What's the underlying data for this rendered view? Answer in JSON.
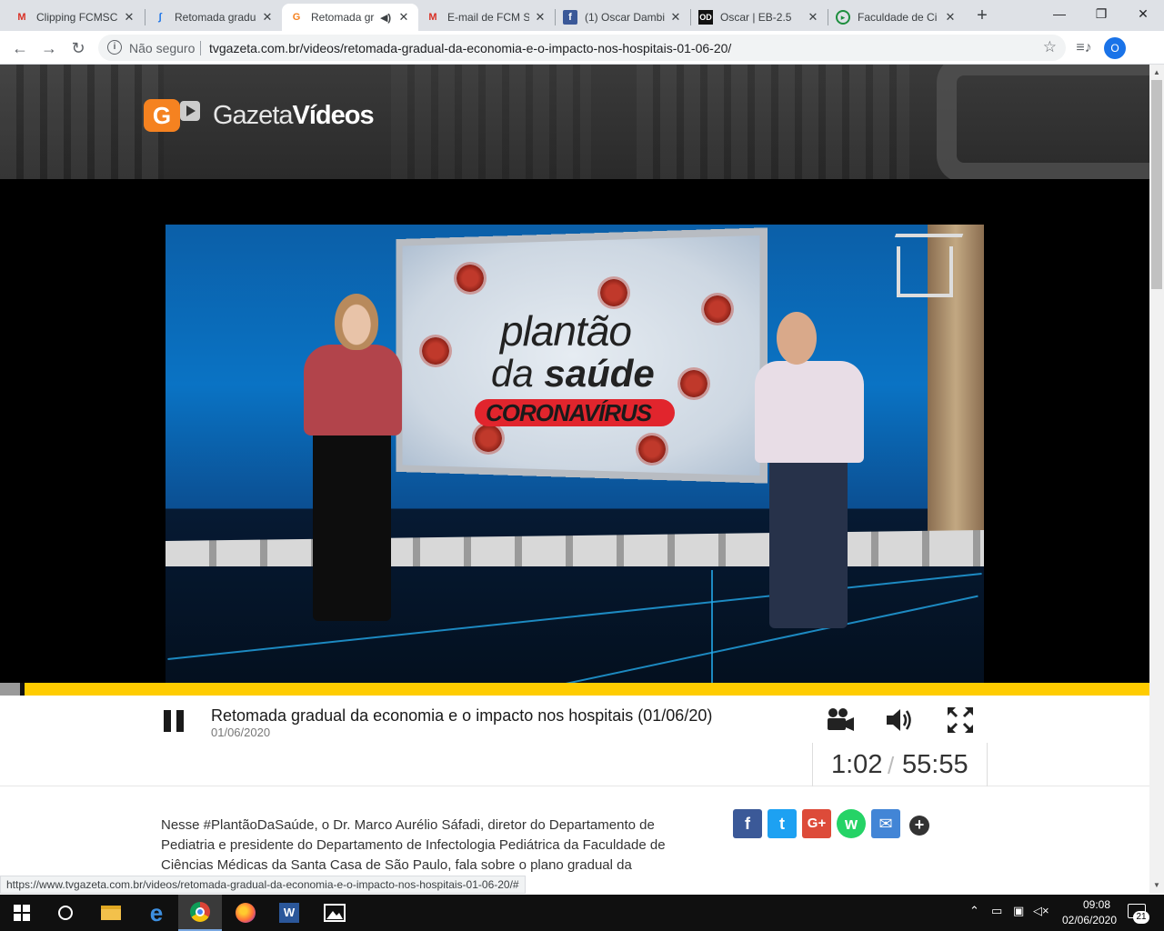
{
  "tabs": [
    {
      "title": "Clipping FCMSC",
      "icon": "gmail-icon"
    },
    {
      "title": "Retomada gradual",
      "icon": "confluence-icon"
    },
    {
      "title": "Retomada gradual",
      "icon": "gazeta-icon",
      "active": true,
      "audio": true
    },
    {
      "title": "E-mail de FCM S",
      "icon": "gmail-icon"
    },
    {
      "title": "(1) Oscar Dambi",
      "icon": "facebook-icon"
    },
    {
      "title": "Oscar | EB-2.5",
      "icon": "od-icon"
    },
    {
      "title": "Faculdade de Ci",
      "icon": "green-circle-icon"
    }
  ],
  "omnibox": {
    "security_label": "Não seguro",
    "url": "tvgazeta.com.br/videos/retomada-gradual-da-economia-e-o-impacto-nos-hospitais-01-06-20/"
  },
  "profile_initial": "O",
  "site": {
    "logo_prefix": "Gazeta",
    "logo_suffix": "Vídeos",
    "logo_letter": "G"
  },
  "video_frame": {
    "line1": "plantão",
    "line2_prefix": "da",
    "line2_bold": "saúde",
    "line3": "CORONAVÍRUS"
  },
  "player": {
    "title": "Retomada gradual da economia e o impacto nos hospitais (01/06/20)",
    "date": "01/06/2020",
    "time_current": "1:02",
    "time_separator": "/",
    "time_total": "55:55",
    "progress_fraction": 0.019
  },
  "description": "Nesse #PlantãoDaSaúde, o Dr. Marco Aurélio Sáfadi, diretor do Departamento de Pediatria e presidente do Departamento de Infectologia Pediátrica da Faculdade de Ciências Médicas da Santa Casa de São Paulo, fala sobre o plano gradual da",
  "share": {
    "facebook": "f",
    "twitter": "t",
    "googleplus": "G+",
    "whatsapp": "w",
    "email": "✉",
    "more": "+"
  },
  "status_url": "https://www.tvgazeta.com.br/videos/retomada-gradual-da-economia-e-o-impacto-nos-hospitais-01-06-20/#",
  "taskbar": {
    "time": "09:08",
    "date": "02/06/2020",
    "notifications": "21"
  },
  "colors": {
    "accent_orange": "#f58220",
    "progress_yellow": "#ffcc00",
    "facebook": "#3b5998",
    "twitter": "#1da1f2",
    "googleplus": "#dd4b39",
    "whatsapp": "#25d366",
    "email": "#4285d6"
  }
}
